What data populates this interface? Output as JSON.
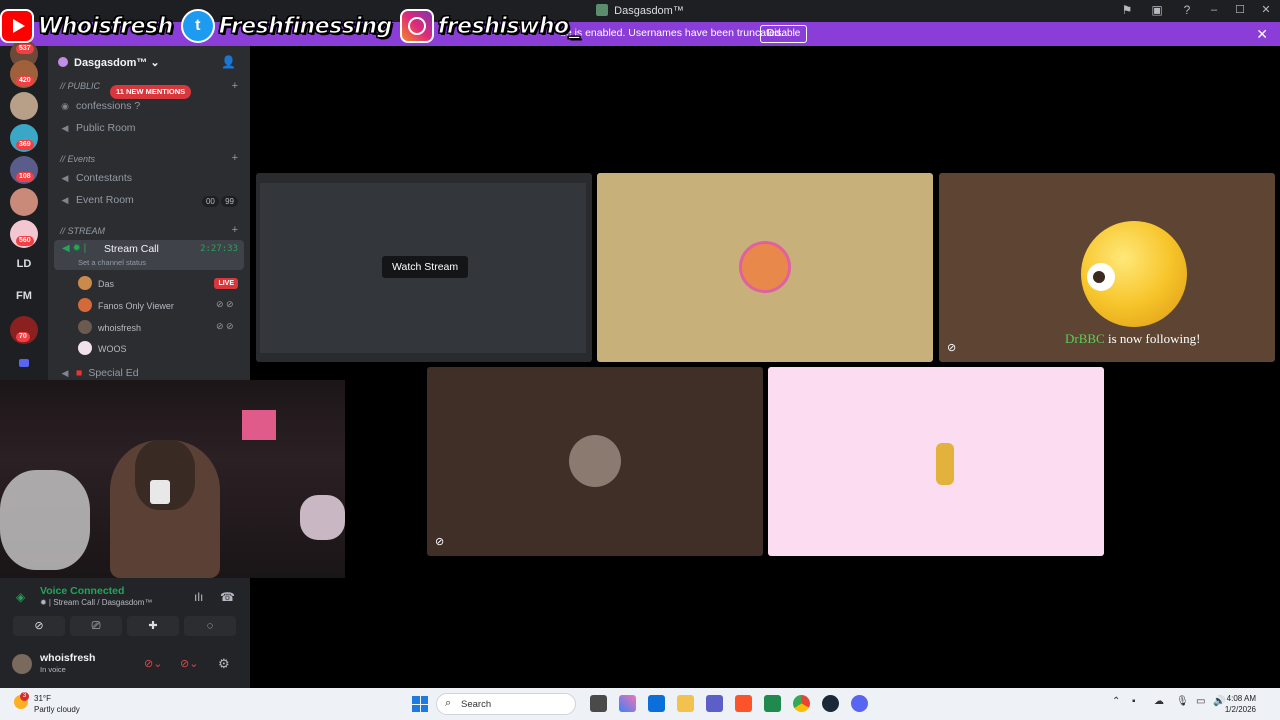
{
  "window": {
    "title": "Dasgasdom™"
  },
  "social": {
    "youtube": "Whoisfresh",
    "twitter": "Freshfinessing",
    "instagram": "freshiswho_"
  },
  "notice": {
    "message": "de is enabled. Usernames have been truncated.",
    "disable_label": "Disable"
  },
  "rail": {
    "badges": [
      "537",
      "420",
      "369",
      "108",
      "560",
      "70"
    ],
    "text_servers": [
      "LD",
      "FM"
    ]
  },
  "sidebar": {
    "guild_name": "Dasgasdom™",
    "mentions": "11 NEW MENTIONS",
    "categories": {
      "public": "// PUBLIC",
      "events": "// Events",
      "stream": "// STREAM"
    },
    "channels": {
      "confessions": "confessions ?",
      "public_room": "Public Room",
      "contestants": "Contestants",
      "event_room": "Event Room",
      "event_badge_a": "00",
      "event_badge_b": "99",
      "stream_call": "Stream Call",
      "stream_timer": "2:27:33",
      "stream_status": "Set a channel status",
      "special_ed": "Special Ed"
    },
    "voice_users": [
      {
        "name": "Das",
        "badge": "LIVE"
      },
      {
        "name": "Fanos Only Viewer"
      },
      {
        "name": "whoisfresh"
      },
      {
        "name": "WOOS"
      }
    ]
  },
  "voice_panel": {
    "status": "Voice Connected",
    "location": "Stream Call / Dasgasdom™",
    "user_name": "whoisfresh",
    "user_status": "In voice"
  },
  "tiles": {
    "watch_stream": "Watch Stream",
    "follow_name": "DrBBC",
    "follow_text": "is now following!"
  },
  "taskbar": {
    "temperature": "31°F",
    "weather": "Partly cloudy",
    "weather_badge": "3",
    "search": "Search",
    "time": "4:08 AM",
    "date": "1/2/2026"
  },
  "colors": {
    "notice_bar": "#8b3dd8",
    "voice_green": "#23a559",
    "live_red": "#da373c",
    "tile_beige": "#c8b07a",
    "tile_brown": "#5e4433",
    "tile_dark_brown": "#3f2f27",
    "tile_pink": "#fbdcf0"
  }
}
